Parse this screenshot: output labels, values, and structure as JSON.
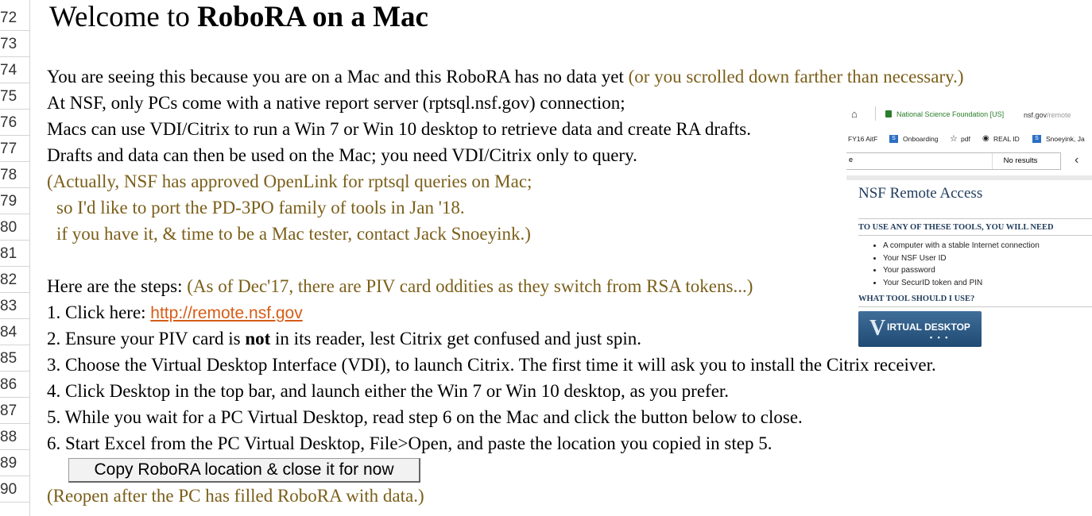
{
  "sheet": {
    "row_numbers": [
      "72",
      "73",
      "74",
      "75",
      "76",
      "77",
      "78",
      "79",
      "80",
      "81",
      "82",
      "83",
      "84",
      "85",
      "86",
      "87",
      "88",
      "89",
      "90"
    ],
    "title_prefix": "Welcome to ",
    "title_bold": "RoboRA on a Mac",
    "l74_a": "You are seeing this because you are on a Mac and this RoboRA has no data yet ",
    "l74_b": "(or you scrolled down farther than necessary.)",
    "l75": "At NSF, only PCs come with a native report server (rptsql.nsf.gov) connection;",
    "l76": "Macs can use VDI/Citrix to run a Win 7 or Win 10 desktop to retrieve data and create RA drafts.",
    "l77": "Drafts and data can then be used on the Mac; you need VDI/Citrix only to query.",
    "l78": "(Actually, NSF has approved OpenLink for rptsql queries on Mac;",
    "l79": "so I'd like to port the PD-3PO family of tools in Jan '18.",
    "l80": "if you have it, & time to be a Mac tester, contact Jack Snoeyink.)",
    "l82_a": "Here are the steps: ",
    "l82_b": "(As of Dec'17, there are PIV card oddities as they switch from RSA tokens...)",
    "l83_a": "1. Click here: ",
    "l83_link": "http://remote.nsf.gov",
    "l84_a": "2. Ensure your PIV card is ",
    "l84_bold": "not",
    "l84_b": " in its reader, lest Citrix get confused and just spin.",
    "l85": "3. Choose the Virtual Desktop Interface (VDI), to launch Citrix.  The first time it will ask you to install the Citrix receiver.",
    "l86": "4. Click Desktop in the top bar, and launch either the Win 7 or Win 10 desktop, as you prefer.",
    "l87": "5. While you wait for a PC Virtual Desktop, read step 6 on the Mac and click the button below to close.",
    "l88": "6. Start Excel from the PC Virtual Desktop, File>Open, and paste the location you copied in step 5.",
    "button_label": "Copy RoboRA location & close it for now",
    "l90": "(Reopen after the PC has filled RoboRA with data.)",
    "colors": {
      "accent_brown": "#7b5f19",
      "link": "#d55d17"
    }
  },
  "screenshot": {
    "secure_label": "National Science Foundation [US]",
    "url_host": "nsf.gov",
    "url_path": "/remote",
    "bookmarks": [
      "FY16 AitF",
      "Onboarding",
      "pdf",
      "REAL ID",
      "Snoeyink, Ja"
    ],
    "search_value": "e",
    "no_results": "No results",
    "heading": "NSF Remote Access",
    "section1": "TO USE ANY OF THESE TOOLS, YOU WILL NEED",
    "needs": [
      "A computer with a stable Internet connection",
      "Your NSF User ID",
      "Your password",
      "Your SecurID token and PIN"
    ],
    "section2": "WHAT TOOL SHOULD I USE?",
    "vdi_label": "IRTUAL DESKTOP",
    "vdi_letter": "V",
    "vdi_dots": "• • •"
  }
}
